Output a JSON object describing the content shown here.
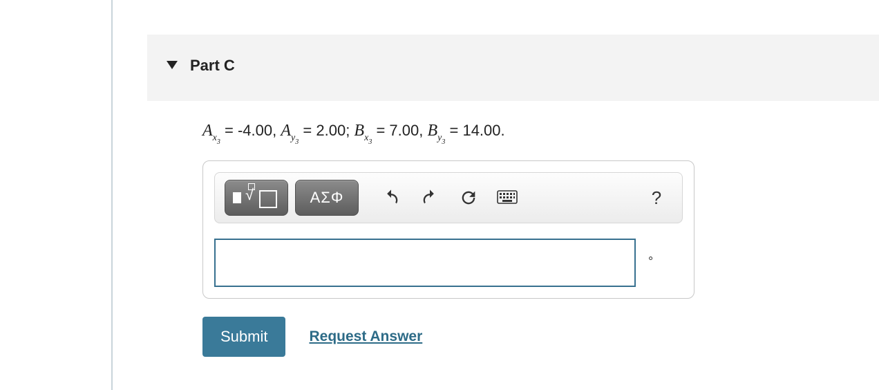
{
  "part": {
    "title": "Part C"
  },
  "prompt": {
    "symbols": {
      "A": "A",
      "B": "B",
      "x": "x",
      "y": "y",
      "idx": "3"
    },
    "Ax": "-4.00",
    "Ay": "2.00",
    "Bx": "7.00",
    "By": "14.00"
  },
  "toolbar": {
    "greek_label": "ΑΣΦ",
    "help_label": "?"
  },
  "input": {
    "value": "",
    "unit": "°"
  },
  "actions": {
    "submit": "Submit",
    "request": "Request Answer"
  }
}
